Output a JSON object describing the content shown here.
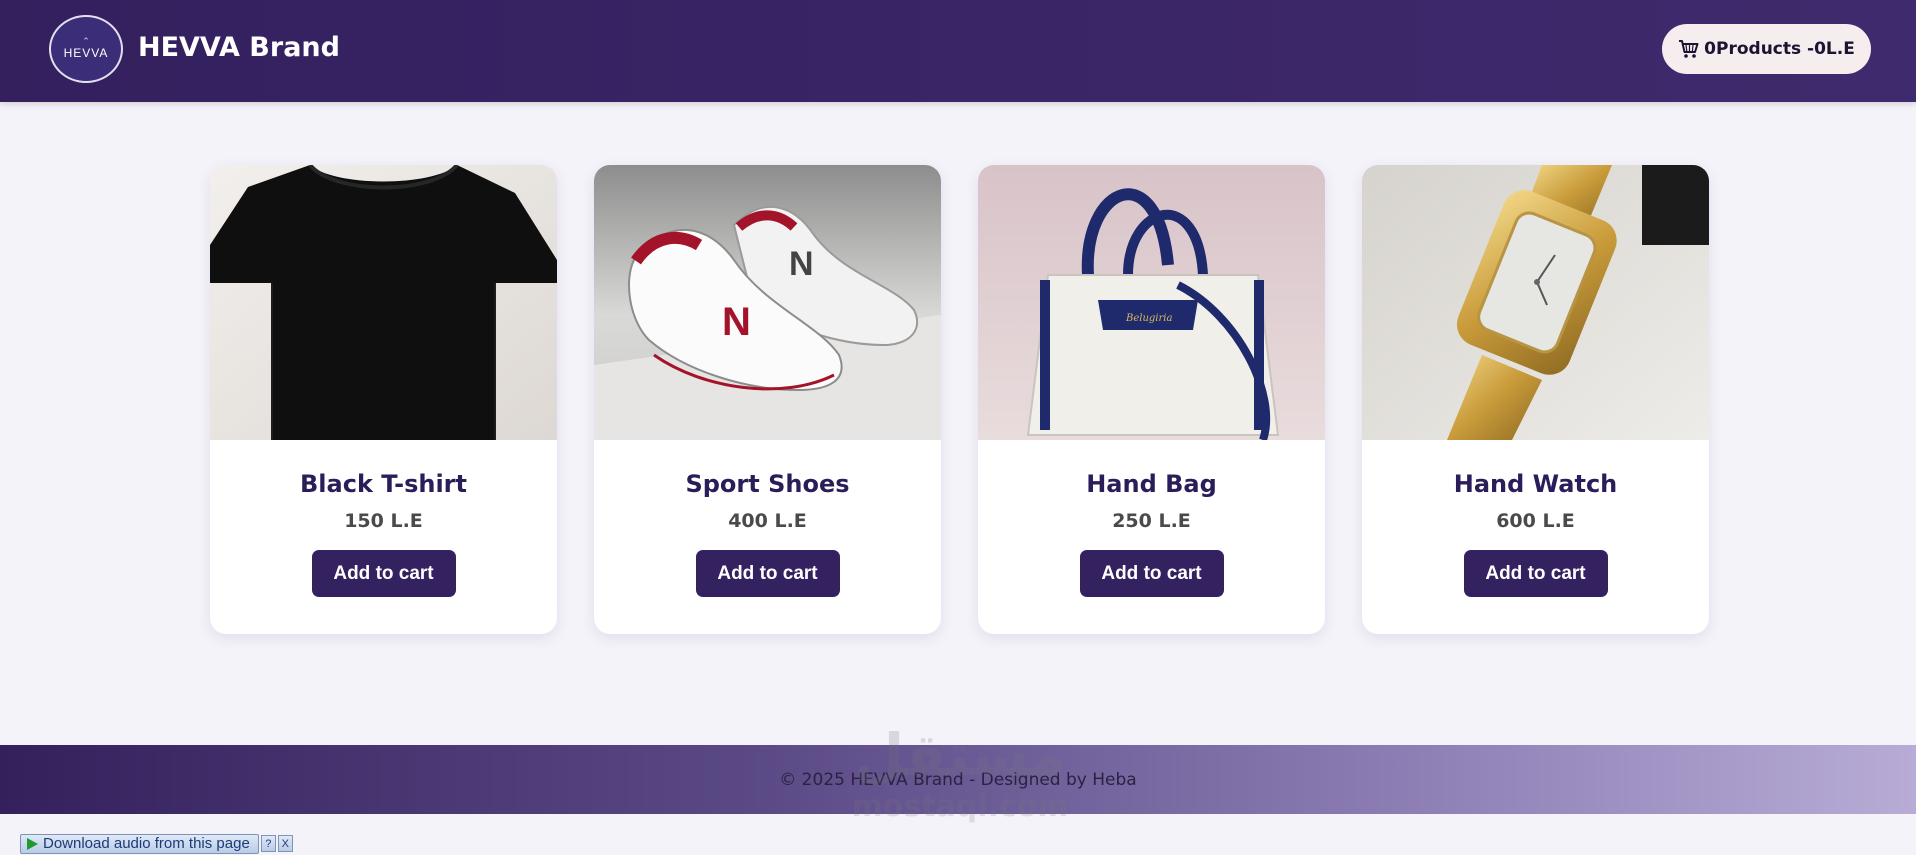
{
  "header": {
    "logo_text": "HEVVA",
    "brand_name": "HEVVA Brand",
    "cart_label": "0Products -0L.E",
    "icons": {
      "cart": "cart-icon"
    }
  },
  "products": [
    {
      "name": "Black T-shirt",
      "price": "150 L.E",
      "button": "Add to cart",
      "image": "black-tshirt-image"
    },
    {
      "name": "Sport Shoes",
      "price": "400 L.E",
      "button": "Add to cart",
      "image": "sport-shoes-image"
    },
    {
      "name": "Hand Bag",
      "price": "250 L.E",
      "button": "Add to cart",
      "image": "hand-bag-image"
    },
    {
      "name": "Hand Watch",
      "price": "600 L.E",
      "button": "Add to cart",
      "image": "hand-watch-image"
    }
  ],
  "footer": {
    "text": "© 2025 HEVVA Brand - Designed by Heba"
  },
  "watermark": {
    "arabic": "مستقل",
    "latin": "mostaql.com"
  },
  "audio_bar": {
    "label": "Download audio from this page",
    "help": "?",
    "close": "X"
  },
  "colors": {
    "header_bg": "#33205d",
    "page_bg": "#f4f3f9",
    "button_bg": "#34215f",
    "title_color": "#2b1c5a"
  }
}
